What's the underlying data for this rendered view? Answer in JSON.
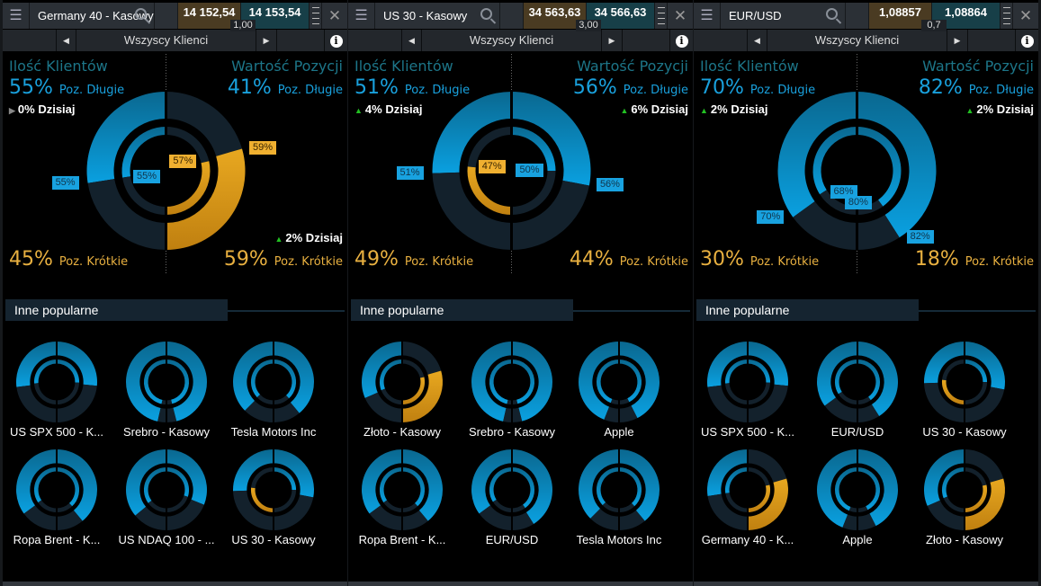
{
  "colors": {
    "long": "#19a0dc",
    "short": "#e0a020",
    "neutral": "#13212c",
    "bid_bg": "#4a3b22",
    "ask_bg": "#173f48"
  },
  "labels": {
    "clients": "Ilość Klientów",
    "value": "Wartość Pozycji",
    "long": "Poz. Długie",
    "short": "Poz. Krótkie",
    "today_suffix": "Dzisiaj",
    "filter": "Wszyscy Klienci",
    "popular": "Inne popularne"
  },
  "icons": [
    "menu-icon",
    "search-icon",
    "grip-icon",
    "close-icon",
    "prev-arrow-icon",
    "next-arrow-icon",
    "info-icon",
    "trend-up-icon"
  ],
  "panels": [
    {
      "instrument": "Germany 40 - Kasowy",
      "bid": "14 152,54",
      "ask": "14 153,54",
      "spread": "1,00",
      "clients": {
        "long": 55,
        "short": 45,
        "long_text": "55%",
        "short_text": "45%",
        "today": "0% Dzisiaj",
        "today_trend": "flat",
        "today_side": "long",
        "inner": 55
      },
      "value": {
        "long": 41,
        "short": 59,
        "long_text": "41%",
        "short_text": "59%",
        "today": "2% Dzisiaj",
        "today_trend": "up",
        "today_side": "short",
        "inner": 43
      },
      "tags": {
        "outer_left": "55%",
        "inner_left": "55%",
        "outer_right": "59%",
        "inner_right": "57%"
      },
      "popular": [
        {
          "name": "US SPX 500 - K...",
          "cl": 54,
          "vl": 53,
          "ci": 52,
          "vi": 51
        },
        {
          "name": "Srebro - Kasowy",
          "cl": 93,
          "vl": 92,
          "ci": 93,
          "vi": 92
        },
        {
          "name": "Tesla Motors Inc",
          "cl": 75,
          "vl": 78,
          "ci": 74,
          "vi": 76
        },
        {
          "name": "Ropa Brent - K...",
          "cl": 70,
          "vl": 78,
          "ci": 69,
          "vi": 76
        },
        {
          "name": "US NDAQ 100 - ...",
          "cl": 72,
          "vl": 62,
          "ci": 70,
          "vi": 60
        },
        {
          "name": "US 30 - Kasowy",
          "cl": 51,
          "vl": 56,
          "ci": 47,
          "vi": 50
        }
      ]
    },
    {
      "instrument": "US 30 - Kasowy",
      "bid": "34 563,63",
      "ask": "34 566,63",
      "spread": "3,00",
      "clients": {
        "long": 51,
        "short": 49,
        "long_text": "51%",
        "short_text": "49%",
        "today": "4% Dzisiaj",
        "today_trend": "up",
        "today_side": "long",
        "inner": 47
      },
      "value": {
        "long": 56,
        "short": 44,
        "long_text": "56%",
        "short_text": "44%",
        "today": "6% Dzisiaj",
        "today_trend": "up",
        "today_side": "long",
        "inner": 50
      },
      "tags": {
        "outer_left": "51%",
        "inner_left": "47%",
        "outer_right": "56%",
        "inner_right": "50%"
      },
      "popular": [
        {
          "name": "Złoto - Kasowy",
          "cl": 63,
          "vl": 41,
          "ci": 62,
          "vi": 43
        },
        {
          "name": "Srebro - Kasowy",
          "cl": 93,
          "vl": 92,
          "ci": 93,
          "vi": 92
        },
        {
          "name": "Apple",
          "cl": 88,
          "vl": 85,
          "ci": 88,
          "vi": 85
        },
        {
          "name": "Ropa Brent - K...",
          "cl": 70,
          "vl": 78,
          "ci": 69,
          "vi": 76
        },
        {
          "name": "EUR/USD",
          "cl": 70,
          "vl": 82,
          "ci": 68,
          "vi": 80
        },
        {
          "name": "Tesla Motors Inc",
          "cl": 75,
          "vl": 78,
          "ci": 74,
          "vi": 76
        }
      ]
    },
    {
      "instrument": "EUR/USD",
      "bid": "1,08857",
      "ask": "1,08864",
      "spread": "0,7",
      "clients": {
        "long": 70,
        "short": 30,
        "long_text": "70%",
        "short_text": "30%",
        "today": "2% Dzisiaj",
        "today_trend": "up",
        "today_side": "long",
        "inner": 68
      },
      "value": {
        "long": 82,
        "short": 18,
        "long_text": "82%",
        "short_text": "18%",
        "today": "2% Dzisiaj",
        "today_trend": "up",
        "today_side": "long",
        "inner": 80
      },
      "tags": {
        "outer_left": "70%",
        "inner_left": "68%",
        "outer_right": "82%",
        "inner_right": "80%"
      },
      "popular": [
        {
          "name": "US SPX 500 - K...",
          "cl": 54,
          "vl": 53,
          "ci": 52,
          "vi": 51
        },
        {
          "name": "EUR/USD",
          "cl": 70,
          "vl": 82,
          "ci": 68,
          "vi": 80
        },
        {
          "name": "US 30 - Kasowy",
          "cl": 51,
          "vl": 56,
          "ci": 47,
          "vi": 50
        },
        {
          "name": "Germany 40 - K...",
          "cl": 55,
          "vl": 41,
          "ci": 55,
          "vi": 43
        },
        {
          "name": "Apple",
          "cl": 88,
          "vl": 85,
          "ci": 88,
          "vi": 85
        },
        {
          "name": "Złoto - Kasowy",
          "cl": 63,
          "vl": 41,
          "ci": 62,
          "vi": 43
        }
      ]
    }
  ]
}
